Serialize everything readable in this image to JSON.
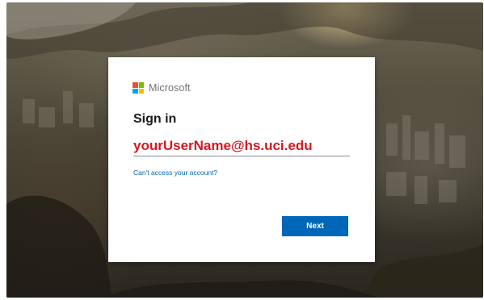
{
  "brand": {
    "name": "Microsoft",
    "logo_colors": [
      "#f25022",
      "#7fba00",
      "#00a4ef",
      "#ffb900"
    ]
  },
  "signin": {
    "title": "Sign in",
    "email_value": "yourUserName@hs.uci.edu",
    "help_link": "Can't access your account?",
    "next_label": "Next"
  },
  "colors": {
    "accent": "#0067b8",
    "email_text": "#d4181f"
  }
}
